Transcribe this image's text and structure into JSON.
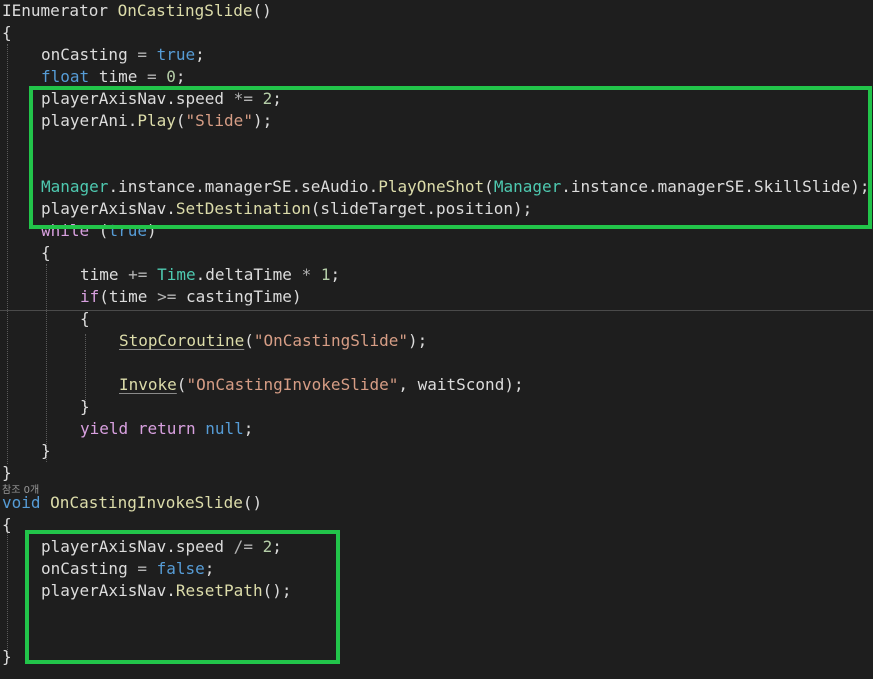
{
  "codelens": "참조 0개",
  "lines": [
    {
      "indent": 0,
      "tokens": [
        [
          "IEnumerator",
          "id"
        ],
        [
          " ",
          "id"
        ],
        [
          "OnCastingSlide",
          "fn"
        ],
        [
          "()",
          "id"
        ]
      ]
    },
    {
      "indent": 0,
      "tokens": [
        [
          "{",
          "id"
        ]
      ]
    },
    {
      "indent": 1,
      "tokens": [
        [
          "onCasting",
          "id"
        ],
        [
          " = ",
          "op"
        ],
        [
          "true",
          "kw"
        ],
        [
          ";",
          "id"
        ]
      ]
    },
    {
      "indent": 1,
      "tokens": [
        [
          "float",
          "kw"
        ],
        [
          " ",
          "id"
        ],
        [
          "time",
          "id"
        ],
        [
          " = ",
          "op"
        ],
        [
          "0",
          "num"
        ],
        [
          ";",
          "id"
        ]
      ]
    },
    {
      "indent": 1,
      "tokens": [
        [
          "playerAxisNav",
          "id"
        ],
        [
          ".",
          "id"
        ],
        [
          "speed",
          "id"
        ],
        [
          " *= ",
          "op"
        ],
        [
          "2",
          "num"
        ],
        [
          ";",
          "id"
        ]
      ]
    },
    {
      "indent": 1,
      "tokens": [
        [
          "playerAni",
          "id"
        ],
        [
          ".",
          "id"
        ],
        [
          "Play",
          "fn"
        ],
        [
          "(",
          "id"
        ],
        [
          "\"Slide\"",
          "str"
        ],
        [
          ");",
          "id"
        ]
      ]
    },
    {
      "indent": 1,
      "tokens": []
    },
    {
      "indent": 1,
      "tokens": []
    },
    {
      "indent": 1,
      "tokens": [
        [
          "Manager",
          "ty"
        ],
        [
          ".",
          "id"
        ],
        [
          "instance",
          "id"
        ],
        [
          ".",
          "id"
        ],
        [
          "managerSE",
          "id"
        ],
        [
          ".",
          "id"
        ],
        [
          "seAudio",
          "id"
        ],
        [
          ".",
          "id"
        ],
        [
          "PlayOneShot",
          "fn"
        ],
        [
          "(",
          "id"
        ],
        [
          "Manager",
          "ty"
        ],
        [
          ".",
          "id"
        ],
        [
          "instance",
          "id"
        ],
        [
          ".",
          "id"
        ],
        [
          "managerSE",
          "id"
        ],
        [
          ".",
          "id"
        ],
        [
          "SkillSlide",
          "id"
        ],
        [
          ");",
          "id"
        ]
      ]
    },
    {
      "indent": 1,
      "tokens": [
        [
          "playerAxisNav",
          "id"
        ],
        [
          ".",
          "id"
        ],
        [
          "SetDestination",
          "fn"
        ],
        [
          "(",
          "id"
        ],
        [
          "slideTarget",
          "id"
        ],
        [
          ".",
          "id"
        ],
        [
          "position",
          "id"
        ],
        [
          ");",
          "id"
        ]
      ]
    },
    {
      "indent": 1,
      "tokens": [
        [
          "while",
          "ctl"
        ],
        [
          " (",
          "id"
        ],
        [
          "true",
          "kw"
        ],
        [
          ")",
          "id"
        ]
      ]
    },
    {
      "indent": 1,
      "tokens": [
        [
          "{",
          "id"
        ]
      ]
    },
    {
      "indent": 2,
      "tokens": [
        [
          "time",
          "id"
        ],
        [
          " += ",
          "op"
        ],
        [
          "Time",
          "ty"
        ],
        [
          ".",
          "id"
        ],
        [
          "deltaTime",
          "id"
        ],
        [
          " * ",
          "op"
        ],
        [
          "1",
          "num"
        ],
        [
          ";",
          "id"
        ]
      ]
    },
    {
      "indent": 2,
      "tokens": [
        [
          "if",
          "ctl"
        ],
        [
          "(",
          "id"
        ],
        [
          "time",
          "id"
        ],
        [
          " >= ",
          "op"
        ],
        [
          "castingTime",
          "id"
        ],
        [
          ")",
          "id"
        ]
      ]
    },
    {
      "indent": 2,
      "tokens": [
        [
          "{",
          "id"
        ]
      ]
    },
    {
      "indent": 3,
      "tokens": [
        [
          "StopCoroutine",
          "fn-und"
        ],
        [
          "(",
          "id"
        ],
        [
          "\"OnCastingSlide\"",
          "str"
        ],
        [
          ");",
          "id"
        ]
      ]
    },
    {
      "indent": 3,
      "tokens": []
    },
    {
      "indent": 3,
      "tokens": [
        [
          "Invoke",
          "fn-und"
        ],
        [
          "(",
          "id"
        ],
        [
          "\"OnCastingInvokeSlide\"",
          "str"
        ],
        [
          ", ",
          "id"
        ],
        [
          "waitScond",
          "id"
        ],
        [
          ");",
          "id"
        ]
      ]
    },
    {
      "indent": 2,
      "tokens": [
        [
          "}",
          "id"
        ]
      ]
    },
    {
      "indent": 2,
      "tokens": [
        [
          "yield",
          "ctl"
        ],
        [
          " ",
          "id"
        ],
        [
          "return",
          "ctl"
        ],
        [
          " ",
          "id"
        ],
        [
          "null",
          "kw"
        ],
        [
          ";",
          "id"
        ]
      ]
    },
    {
      "indent": 1,
      "tokens": [
        [
          "}",
          "id"
        ]
      ]
    },
    {
      "indent": 0,
      "tokens": [
        [
          "}",
          "id"
        ]
      ]
    },
    {
      "indent": 0,
      "tokens": [
        [
          "void",
          "kw"
        ],
        [
          " ",
          "id"
        ],
        [
          "OnCastingInvokeSlide",
          "fn"
        ],
        [
          "()",
          "id"
        ]
      ]
    },
    {
      "indent": 0,
      "tokens": [
        [
          "{",
          "id"
        ]
      ]
    },
    {
      "indent": 1,
      "tokens": [
        [
          "playerAxisNav",
          "id"
        ],
        [
          ".",
          "id"
        ],
        [
          "speed",
          "id"
        ],
        [
          " /= ",
          "op"
        ],
        [
          "2",
          "num"
        ],
        [
          ";",
          "id"
        ]
      ]
    },
    {
      "indent": 1,
      "tokens": [
        [
          "onCasting",
          "id"
        ],
        [
          " = ",
          "op"
        ],
        [
          "false",
          "kw"
        ],
        [
          ";",
          "id"
        ]
      ]
    },
    {
      "indent": 1,
      "tokens": [
        [
          "playerAxisNav",
          "id"
        ],
        [
          ".",
          "id"
        ],
        [
          "ResetPath",
          "fn"
        ],
        [
          "();",
          "id"
        ]
      ]
    },
    {
      "indent": 1,
      "tokens": []
    },
    {
      "indent": 1,
      "tokens": []
    },
    {
      "indent": 0,
      "tokens": [
        [
          "}",
          "id"
        ]
      ]
    }
  ],
  "colors": {
    "background": "#1e1e1e",
    "identifier": "#dcdcdc",
    "keyword": "#569cd6",
    "type": "#4ec9b0",
    "method": "#dcdcaa",
    "string": "#d69d85",
    "number": "#b5cea8",
    "control": "#d8a0df",
    "highlight_box": "#22c44a"
  }
}
